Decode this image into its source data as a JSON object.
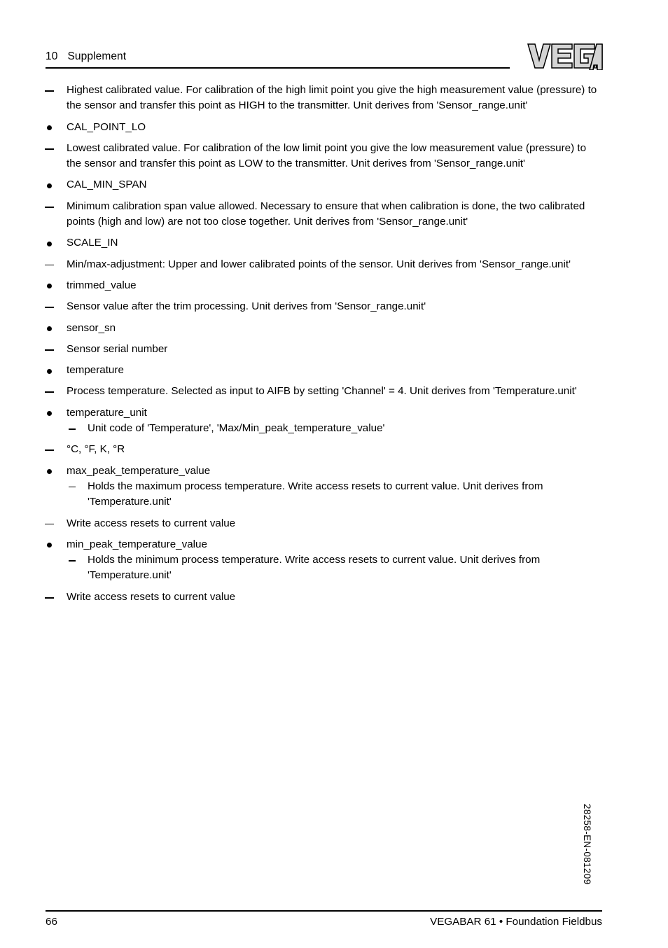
{
  "header": {
    "chapter_number": "10",
    "chapter_title": "Supplement",
    "logo": "vega-logo"
  },
  "content": {
    "items": [
      {
        "marker": "dash",
        "text": "Highest calibrated value. For calibration of the high limit point you give the high measurement value (pressure) to the sensor and transfer this point as HIGH to the transmitter. Unit derives from 'Sensor_range.unit'"
      },
      {
        "marker": "bullet",
        "text": "CAL_POINT_LO"
      },
      {
        "marker": "dash",
        "text": "Lowest calibrated value. For calibration of the low limit point you give the low measurement value (pressure) to the sensor and transfer this point as LOW to the transmitter. Unit derives from 'Sensor_range.unit'"
      },
      {
        "marker": "bullet",
        "text": "CAL_MIN_SPAN"
      },
      {
        "marker": "dash",
        "text": "Minimum calibration span value allowed. Necessary to ensure that when calibration is done, the two calibrated points (high and low) are not too close together. Unit derives from 'Sensor_range.unit'"
      },
      {
        "marker": "bullet",
        "text": "SCALE_IN"
      },
      {
        "marker": "dash",
        "text": "Min/max-adjustment: Upper and lower calibrated points of the sensor. Unit derives from 'Sensor_range.unit'"
      },
      {
        "marker": "bullet",
        "text": "trimmed_value"
      },
      {
        "marker": "dash",
        "text": "Sensor value after the trim processing. Unit derives from 'Sensor_range.unit'"
      },
      {
        "marker": "bullet",
        "text": "sensor_sn"
      },
      {
        "marker": "dash",
        "text": "Sensor serial number"
      },
      {
        "marker": "bullet",
        "text": "temperature"
      },
      {
        "marker": "dash",
        "text": "Process temperature. Selected as input to AIFB by setting 'Channel' = 4. Unit derives from 'Temperature.unit'"
      },
      {
        "marker": "bullet",
        "text": "temperature_unit",
        "subitems": [
          {
            "marker": "subdash",
            "text": "Unit code of 'Temperature', 'Max/Min_peak_temperature_value'"
          }
        ]
      },
      {
        "marker": "dash",
        "text": "°C, °F, K, °R"
      },
      {
        "marker": "bullet",
        "text": "max_peak_temperature_value",
        "subitems": [
          {
            "marker": "subdash",
            "text": "Holds the maximum process temperature. Write access resets to current value. Unit derives from 'Temperature.unit'"
          }
        ]
      },
      {
        "marker": "dash",
        "text": "Write access resets to current value"
      },
      {
        "marker": "bullet",
        "text": "min_peak_temperature_value",
        "subitems": [
          {
            "marker": "subdash",
            "text": "Holds the minimum process temperature. Write access resets to current value. Unit derives from 'Temperature.unit'"
          }
        ]
      },
      {
        "marker": "dash",
        "text": "Write access resets to current value"
      }
    ]
  },
  "footer": {
    "page_number": "66",
    "document_line": "VEGABAR 61 • Foundation Fieldbus",
    "side_code": "28258-EN-081209"
  }
}
